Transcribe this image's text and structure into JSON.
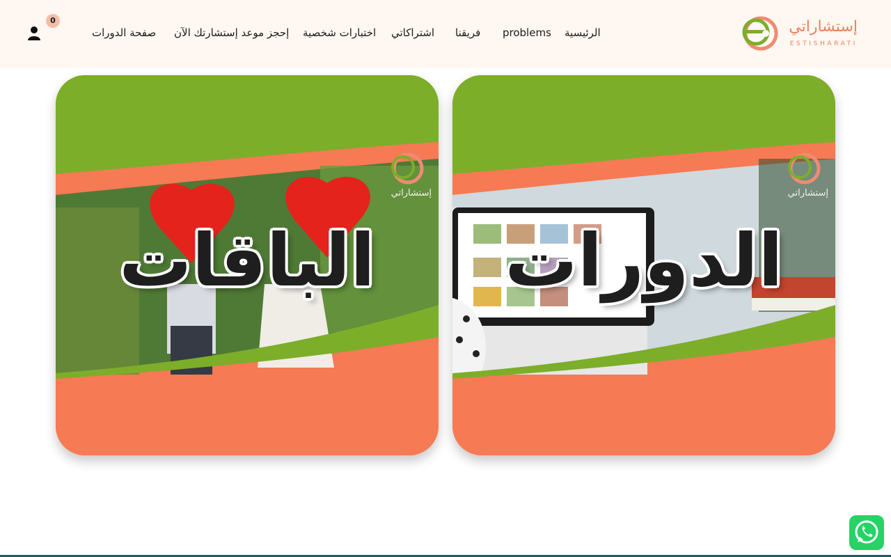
{
  "logo": {
    "arabic": "إستشاراتي",
    "latin": "ESTISHARATI"
  },
  "nav": {
    "items": [
      {
        "label": "الرئيسية"
      },
      {
        "label": "problems"
      },
      {
        "label": "فريقنا"
      },
      {
        "label": "اشتراكاتي"
      },
      {
        "label": "اختبارات شخصية"
      },
      {
        "label": "إحجز موعد إستشارتك الآن"
      },
      {
        "label": "صفحة الدورات"
      }
    ]
  },
  "cart": {
    "count": "0"
  },
  "cards": [
    {
      "title": "الدورات",
      "brand": "إستشاراتي"
    },
    {
      "title": "الباقات",
      "brand": "إستشاراتي"
    }
  ],
  "colors": {
    "header_bg": "#fff7f1",
    "brand_orange": "#e7835e",
    "card_green": "#7cae2a",
    "card_orange": "#f67a54",
    "whatsapp": "#25d366"
  },
  "icons": [
    "user-icon",
    "whatsapp-icon",
    "brand-logo-icon"
  ]
}
